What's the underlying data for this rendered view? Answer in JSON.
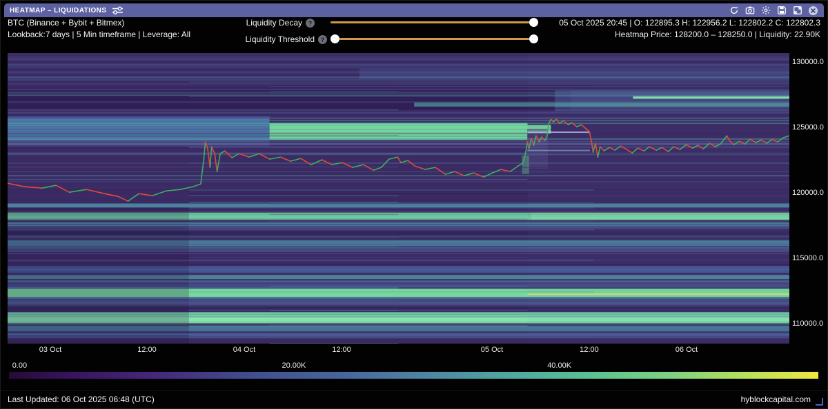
{
  "titlebar": {
    "title": "HEATMAP – LIQUIDATIONS",
    "icons": [
      "refresh-icon",
      "screenshot-icon",
      "settings-icon",
      "save-icon",
      "expand-icon",
      "close-icon"
    ]
  },
  "header": {
    "instrument": "BTC (Binance + Bybit + Bitmex)",
    "meta": "Lookback:7 days | 5 Min timeframe | Leverage: All",
    "ohlc": "05 Oct 2025 20:45 | O: 122895.3 H: 122956.2 L: 122802.2 C: 122802.3",
    "heatmap_info": "Heatmap Price: 128200.0 – 128250.0 | Liquidity: 22.90K",
    "sliders": [
      {
        "label": "Liquidity Decay",
        "info_glyph": "?"
      },
      {
        "label": "Liquidity Threshold",
        "info_glyph": "?"
      }
    ]
  },
  "footer": {
    "last_updated": "Last Updated: 06 Oct 2025 06:48 (UTC)",
    "site": "hyblockcapital.com"
  },
  "colors": {
    "titlebar_bg": "#5d61a2",
    "slider_track": "#cf9a4e",
    "price_up": "#3fae62",
    "price_down": "#e04b3a",
    "heatmap_base": "#3b2a63"
  },
  "chart_data": {
    "type": "heatmap",
    "title": "BTC liquidation heatmap, 7 days, 5 min",
    "y_axis": {
      "labels": [
        "130000.0",
        "125000.0",
        "120000.0",
        "115000.0",
        "110000.0"
      ],
      "values": [
        130000,
        125000,
        120000,
        115000,
        110000
      ],
      "range": [
        108550,
        130740
      ]
    },
    "x_axis": {
      "labels": [
        "03 Oct",
        "12:00",
        "04 Oct",
        "12:00",
        "05 Oct",
        "12:00",
        "06 Oct"
      ],
      "positions_frac": [
        0.0547,
        0.1783,
        0.3027,
        0.4272,
        0.6196,
        0.744,
        0.8685
      ]
    },
    "colorbar": {
      "labels": [
        "0.00",
        "20.00K",
        "40.00K"
      ],
      "positions_frac": [
        0.004,
        0.352,
        0.68
      ],
      "gradient": [
        [
          0,
          "#250a38"
        ],
        [
          8,
          "#3a1460"
        ],
        [
          18,
          "#45277c"
        ],
        [
          30,
          "#414f8f"
        ],
        [
          42,
          "#47699d"
        ],
        [
          52,
          "#4d87a5"
        ],
        [
          62,
          "#4fa8a0"
        ],
        [
          72,
          "#59c291"
        ],
        [
          82,
          "#7ed37f"
        ],
        [
          90,
          "#b0de5f"
        ],
        [
          100,
          "#f0e83f"
        ]
      ]
    },
    "liquidity_bands": [
      {
        "p1": 129950,
        "p2": 129750,
        "x1": 0,
        "x2": 1,
        "c": "#4a5a96",
        "o": 0.5
      },
      {
        "p1": 129400,
        "p2": 129250,
        "x1": 0,
        "x2": 1,
        "c": "#44508c",
        "o": 0.45
      },
      {
        "p1": 129550,
        "p2": 128750,
        "x1": 0.45,
        "x2": 1,
        "c": "#4a5590",
        "o": 0.5
      },
      {
        "p1": 128450,
        "p2": 128330,
        "x1": 0,
        "x2": 1,
        "c": "#445088",
        "o": 0.45
      },
      {
        "p1": 127900,
        "p2": 126400,
        "x1": 0,
        "x2": 0.72,
        "c": "#2e1d52",
        "o": 0.8
      },
      {
        "p1": 127900,
        "p2": 126300,
        "x1": 0.7,
        "x2": 1,
        "c": "#50619e",
        "o": 0.5
      },
      {
        "p1": 127450,
        "p2": 127230,
        "x1": 0.8,
        "x2": 1,
        "c": "#8ce9a9",
        "o": 0.95
      },
      {
        "p1": 126980,
        "p2": 126650,
        "x1": 0.52,
        "x2": 1,
        "c": "#55b2a4",
        "o": 0.6
      },
      {
        "p1": 126250,
        "p2": 126120,
        "x1": 0,
        "x2": 1,
        "c": "#4a5a96",
        "o": 0.5
      },
      {
        "p1": 125900,
        "p2": 125550,
        "x1": 0,
        "x2": 0.335,
        "c": "#43629e",
        "o": 0.7
      },
      {
        "p1": 125700,
        "p2": 124050,
        "x1": 0,
        "x2": 0.335,
        "c": "#4d7fae",
        "o": 0.85
      },
      {
        "p1": 125400,
        "p2": 124100,
        "x1": 0.335,
        "x2": 0.665,
        "c": "#78dfa0",
        "o": 0.95
      },
      {
        "p1": 125250,
        "p2": 124600,
        "x1": 0.665,
        "x2": 0.695,
        "c": "#78dfa0",
        "o": 0.9
      },
      {
        "p1": 124050,
        "p2": 123600,
        "x1": 0,
        "x2": 0.335,
        "c": "#4a4a85",
        "o": 0.6
      },
      {
        "p1": 124950,
        "p2": 121900,
        "x1": 0.6646,
        "x2": 0.6911,
        "c": "#52447e",
        "o": 0.55
      },
      {
        "p1": 124750,
        "p2": 124640,
        "x1": 0.665,
        "x2": 0.745,
        "c": "#b8cce8",
        "o": 0.75
      },
      {
        "p1": 123350,
        "p2": 123240,
        "x1": 0.665,
        "x2": 0.745,
        "c": "#9ab4d8",
        "o": 0.6
      },
      {
        "p1": 122900,
        "p2": 121500,
        "x1": 0.658,
        "x2": 0.667,
        "c": "#5fc08a",
        "o": 0.45
      },
      {
        "p1": 120400,
        "p2": 119300,
        "x1": 0,
        "x2": 1,
        "c": "#3a2a63",
        "o": 0.6
      },
      {
        "p1": 119250,
        "p2": 118950,
        "x1": 0,
        "x2": 1,
        "c": "#4f96ac",
        "o": 0.8
      },
      {
        "p1": 118550,
        "p2": 118000,
        "x1": 0,
        "x2": 1,
        "c": "#74dba1",
        "o": 0.95
      },
      {
        "p1": 118550,
        "p2": 118000,
        "x1": 0.67,
        "x2": 1,
        "c": "#8ae8a8",
        "o": 0.6
      },
      {
        "p1": 117800,
        "p2": 117350,
        "x1": 0,
        "x2": 1,
        "c": "#49588f",
        "o": 0.8
      },
      {
        "p1": 117100,
        "p2": 116580,
        "x1": 0,
        "x2": 1,
        "c": "#33255a",
        "o": 0.85
      },
      {
        "p1": 116430,
        "p2": 116000,
        "x1": 0,
        "x2": 1,
        "c": "#4f96ac",
        "o": 0.75
      },
      {
        "p1": 115950,
        "p2": 115550,
        "x1": 0,
        "x2": 1,
        "c": "#49588f",
        "o": 0.7
      },
      {
        "p1": 115150,
        "p2": 114750,
        "x1": 0,
        "x2": 1,
        "c": "#3a2a63",
        "o": 0.8
      },
      {
        "p1": 114480,
        "p2": 113950,
        "x1": 0,
        "x2": 1,
        "c": "#4a5f9c",
        "o": 0.8
      },
      {
        "p1": 113800,
        "p2": 113480,
        "x1": 0,
        "x2": 1,
        "c": "#52a8ac",
        "o": 0.7
      },
      {
        "p1": 113300,
        "p2": 112800,
        "x1": 0,
        "x2": 1,
        "c": "#49588f",
        "o": 0.75
      },
      {
        "p1": 112740,
        "p2": 112100,
        "x1": 0,
        "x2": 1,
        "c": "#79dfa0",
        "o": 0.95
      },
      {
        "p1": 112380,
        "p2": 112270,
        "x1": 0.665,
        "x2": 1,
        "c": "#cfe468",
        "o": 0.95
      },
      {
        "p1": 112050,
        "p2": 111500,
        "x1": 0,
        "x2": 1,
        "c": "#49588f",
        "o": 0.8
      },
      {
        "p1": 111480,
        "p2": 111060,
        "x1": 0,
        "x2": 1,
        "c": "#372a60",
        "o": 0.85
      },
      {
        "p1": 110950,
        "p2": 110100,
        "x1": 0,
        "x2": 1,
        "c": "#76dba2",
        "o": 0.95
      },
      {
        "p1": 110650,
        "p2": 110250,
        "x1": 0,
        "x2": 1,
        "c": "#90ecae",
        "o": 0.7
      },
      {
        "p1": 109900,
        "p2": 109480,
        "x1": 0,
        "x2": 1,
        "c": "#4f96ac",
        "o": 0.7
      },
      {
        "p1": 109400,
        "p2": 108950,
        "x1": 0,
        "x2": 1,
        "c": "#454f8a",
        "o": 0.8
      },
      {
        "p1": 108900,
        "p2": 108550,
        "x1": 0,
        "x2": 1,
        "c": "#3a2a5e",
        "o": 0.9
      },
      {
        "p1": 118950,
        "p2": 108550,
        "x1": 0,
        "x2": 0.232,
        "c": "#1f1440",
        "o": 0.22
      },
      {
        "p1": 130740,
        "p2": 108550,
        "x1": 0.665,
        "x2": 1,
        "c": "#6a7ab8",
        "o": 0.05
      }
    ],
    "texture": {
      "seed": 11,
      "count": 170,
      "palette": [
        "#4a5a96",
        "#55628f",
        "#3d2f68",
        "#4f86b0",
        "#52b0a0",
        "#6a78b0",
        "#2e1d52"
      ],
      "x_breaks": [
        0,
        0.232,
        0.335,
        0.5,
        0.665,
        0.75,
        1
      ]
    },
    "price_line": {
      "points": [
        [
          0.0,
          120793
        ],
        [
          0.022,
          120530
        ],
        [
          0.044,
          120425
        ],
        [
          0.062,
          120635
        ],
        [
          0.079,
          120109
        ],
        [
          0.101,
          120319
        ],
        [
          0.124,
          120004
        ],
        [
          0.141,
          119793
        ],
        [
          0.154,
          119425
        ],
        [
          0.168,
          120004
        ],
        [
          0.185,
          119846
        ],
        [
          0.203,
          120214
        ],
        [
          0.221,
          120319
        ],
        [
          0.237,
          120530
        ],
        [
          0.247,
          120741
        ],
        [
          0.251,
          122635
        ],
        [
          0.253,
          123951
        ],
        [
          0.256,
          123425
        ],
        [
          0.259,
          122004
        ],
        [
          0.261,
          123583
        ],
        [
          0.265,
          123057
        ],
        [
          0.268,
          121688
        ],
        [
          0.272,
          123057
        ],
        [
          0.278,
          123267
        ],
        [
          0.287,
          122741
        ],
        [
          0.296,
          123057
        ],
        [
          0.309,
          122793
        ],
        [
          0.322,
          123057
        ],
        [
          0.335,
          122635
        ],
        [
          0.349,
          122793
        ],
        [
          0.362,
          122478
        ],
        [
          0.375,
          122688
        ],
        [
          0.388,
          122214
        ],
        [
          0.402,
          122583
        ],
        [
          0.415,
          122214
        ],
        [
          0.428,
          122372
        ],
        [
          0.441,
          122004
        ],
        [
          0.455,
          122214
        ],
        [
          0.468,
          121793
        ],
        [
          0.478,
          122004
        ],
        [
          0.488,
          122635
        ],
        [
          0.499,
          122793
        ],
        [
          0.503,
          122372
        ],
        [
          0.512,
          122530
        ],
        [
          0.521,
          122109
        ],
        [
          0.534,
          121846
        ],
        [
          0.547,
          122004
        ],
        [
          0.56,
          121478
        ],
        [
          0.572,
          121688
        ],
        [
          0.584,
          121372
        ],
        [
          0.596,
          121583
        ],
        [
          0.609,
          121267
        ],
        [
          0.62,
          121583
        ],
        [
          0.631,
          121846
        ],
        [
          0.643,
          121688
        ],
        [
          0.653,
          122109
        ],
        [
          0.659,
          122320
        ],
        [
          0.662,
          122899
        ],
        [
          0.665,
          123951
        ],
        [
          0.667,
          123425
        ],
        [
          0.67,
          124214
        ],
        [
          0.673,
          123688
        ],
        [
          0.676,
          124425
        ],
        [
          0.68,
          123951
        ],
        [
          0.683,
          124320
        ],
        [
          0.687,
          124056
        ],
        [
          0.69,
          124372
        ],
        [
          0.692,
          125267
        ],
        [
          0.695,
          125688
        ],
        [
          0.698,
          125478
        ],
        [
          0.702,
          125688
        ],
        [
          0.706,
          125372
        ],
        [
          0.711,
          125583
        ],
        [
          0.717,
          125267
        ],
        [
          0.722,
          125425
        ],
        [
          0.728,
          125109
        ],
        [
          0.734,
          125267
        ],
        [
          0.74,
          124951
        ],
        [
          0.744,
          124741
        ],
        [
          0.747,
          123951
        ],
        [
          0.749,
          123162
        ],
        [
          0.752,
          123846
        ],
        [
          0.755,
          122793
        ],
        [
          0.758,
          123583
        ],
        [
          0.763,
          123267
        ],
        [
          0.77,
          123530
        ],
        [
          0.777,
          123320
        ],
        [
          0.784,
          123635
        ],
        [
          0.792,
          123372
        ],
        [
          0.799,
          123109
        ],
        [
          0.806,
          123478
        ],
        [
          0.814,
          123267
        ],
        [
          0.821,
          123583
        ],
        [
          0.83,
          123320
        ],
        [
          0.837,
          123530
        ],
        [
          0.845,
          123214
        ],
        [
          0.852,
          123583
        ],
        [
          0.86,
          123372
        ],
        [
          0.868,
          123741
        ],
        [
          0.876,
          123478
        ],
        [
          0.883,
          123688
        ],
        [
          0.89,
          123425
        ],
        [
          0.898,
          123846
        ],
        [
          0.905,
          123583
        ],
        [
          0.912,
          123793
        ],
        [
          0.92,
          124425
        ],
        [
          0.924,
          124004
        ],
        [
          0.929,
          123741
        ],
        [
          0.936,
          124004
        ],
        [
          0.943,
          123793
        ],
        [
          0.95,
          124162
        ],
        [
          0.957,
          123899
        ],
        [
          0.964,
          124109
        ],
        [
          0.971,
          123846
        ],
        [
          0.978,
          124162
        ],
        [
          0.985,
          123951
        ],
        [
          0.992,
          124267
        ],
        [
          1.0,
          124425
        ]
      ]
    }
  }
}
